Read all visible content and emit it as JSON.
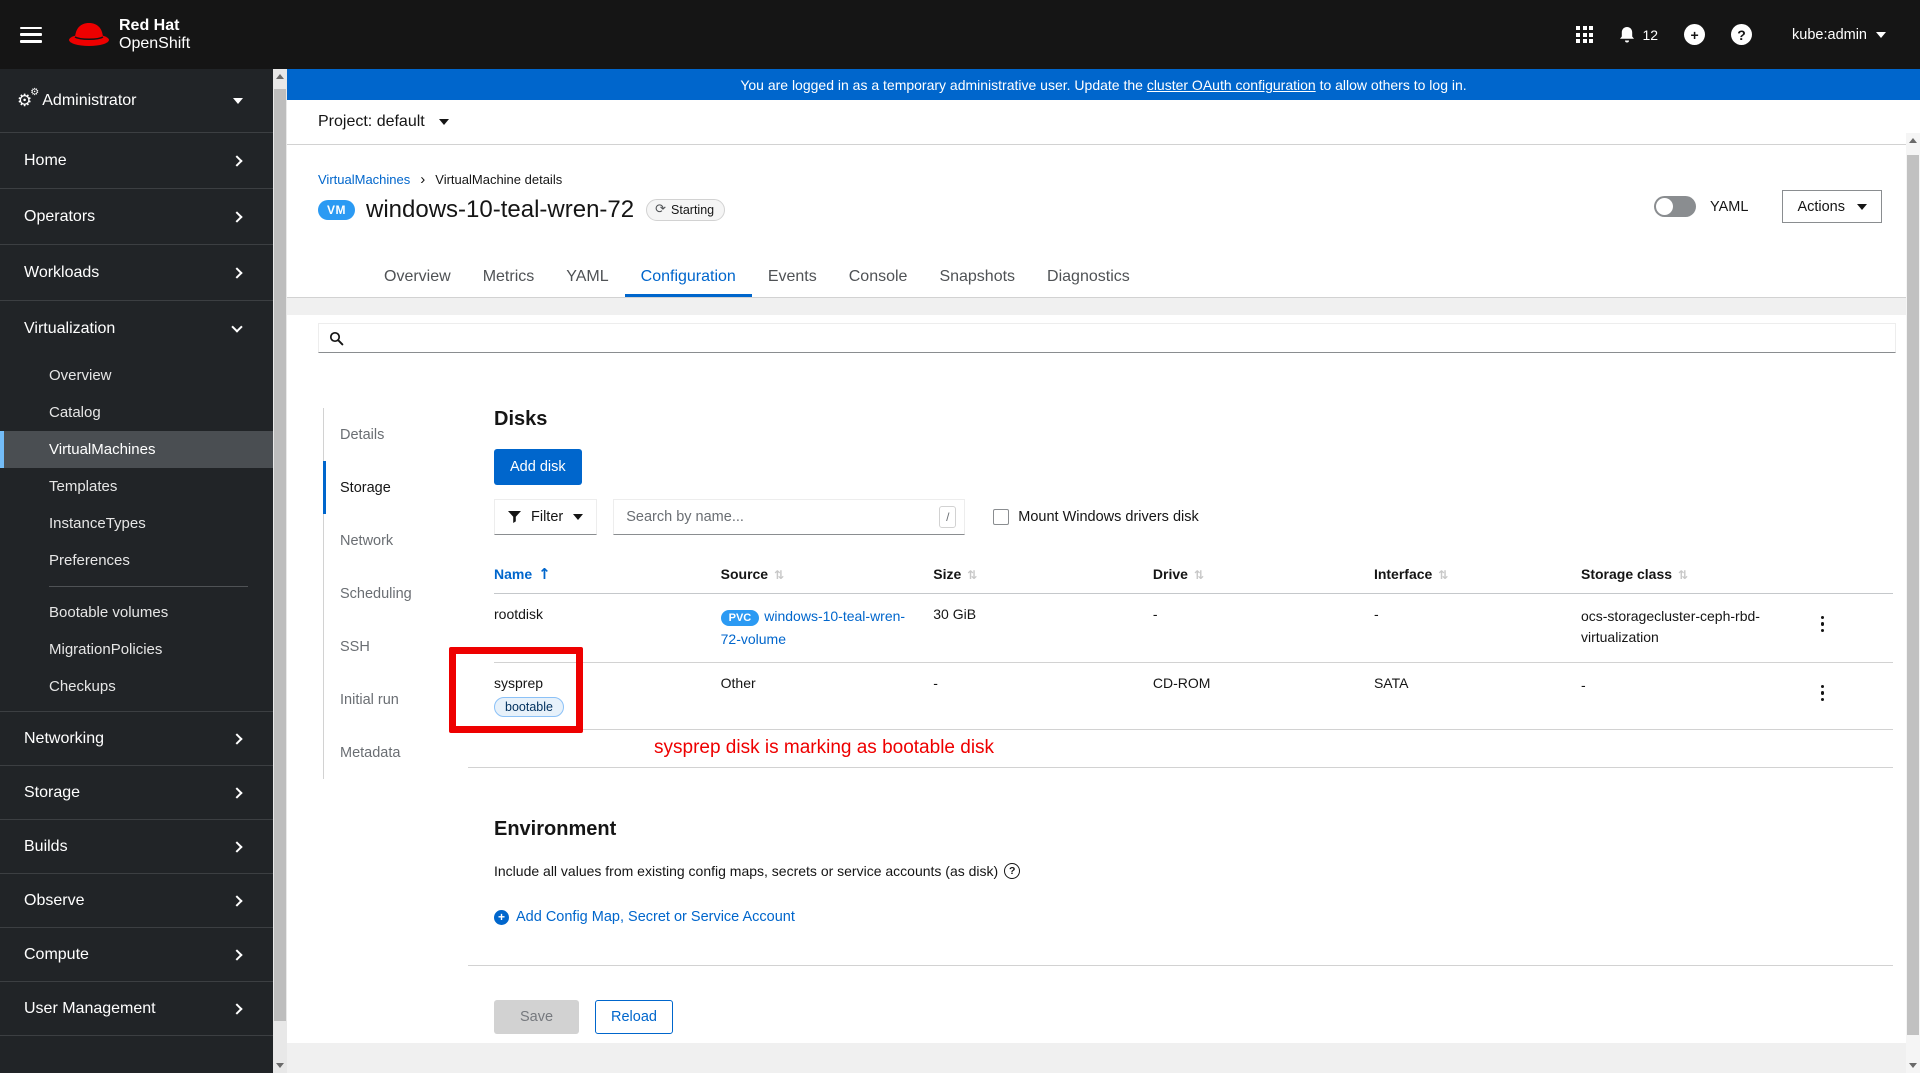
{
  "masthead": {
    "brand_line1": "Red Hat",
    "brand_line2": "OpenShift",
    "notification_count": "12",
    "user": "kube:admin"
  },
  "banner": {
    "prefix": "You are logged in as a temporary administrative user. Update the ",
    "link_text": "cluster OAuth configuration",
    "suffix": " to allow others to log in."
  },
  "project_bar": {
    "label": "Project: default"
  },
  "sidebar": {
    "perspective": "Administrator",
    "items": [
      "Home",
      "Operators",
      "Workloads",
      "Virtualization",
      "Networking",
      "Storage",
      "Builds",
      "Observe",
      "Compute",
      "User Management"
    ],
    "virtualization_children": [
      "Overview",
      "Catalog",
      "VirtualMachines",
      "Templates",
      "InstanceTypes",
      "Preferences",
      "Bootable volumes",
      "MigrationPolicies",
      "Checkups"
    ],
    "active_child": "VirtualMachines"
  },
  "breadcrumb": {
    "link": "VirtualMachines",
    "current": "VirtualMachine details"
  },
  "page_header": {
    "badge": "VM",
    "title": "windows-10-teal-wren-72",
    "status": "Starting",
    "yaml_label": "YAML",
    "actions_label": "Actions"
  },
  "tabs": {
    "items": [
      "Overview",
      "Metrics",
      "YAML",
      "Configuration",
      "Events",
      "Console",
      "Snapshots",
      "Diagnostics"
    ],
    "active": "Configuration"
  },
  "config_nav": {
    "items": [
      "Details",
      "Storage",
      "Network",
      "Scheduling",
      "SSH",
      "Initial run",
      "Metadata"
    ],
    "active": "Storage"
  },
  "disks": {
    "title": "Disks",
    "add_button": "Add disk",
    "filter_label": "Filter",
    "search_placeholder": "Search by name...",
    "shortcut_key": "/",
    "mount_checkbox_label": "Mount Windows drivers disk",
    "columns": [
      "Name",
      "Source",
      "Size",
      "Drive",
      "Interface",
      "Storage class"
    ],
    "rows": [
      {
        "name": "rootdisk",
        "source_badge": "PVC",
        "source_text": "windows-10-teal-wren-72-volume",
        "size": "30 GiB",
        "drive": "-",
        "interface": "-",
        "storage_class": "ocs-storagecluster-ceph-rbd-virtualization"
      },
      {
        "name": "sysprep",
        "bootable_label": "bootable",
        "source_text": "Other",
        "size": "-",
        "drive": "CD-ROM",
        "interface": "SATA",
        "storage_class": "-"
      }
    ],
    "annotation": "sysprep disk is marking as bootable disk"
  },
  "environment": {
    "title": "Environment",
    "description": "Include all values from existing config maps, secrets or service accounts (as disk)",
    "add_link": "Add Config Map, Secret or Service Account"
  },
  "footer": {
    "save": "Save",
    "reload": "Reload"
  },
  "icons": {
    "sort_asc": "↑",
    "sort_none": "⇅",
    "status_spinner": "⟳",
    "breadcrumb_separator": "›",
    "help": "?",
    "plus": "+",
    "cogs": "⚙"
  },
  "colors": {
    "accent_blue": "#0066cc",
    "badge_blue": "#2b9af3",
    "annotation_red": "#ee0000",
    "masthead_bg": "#151515",
    "sidebar_bg": "#212427",
    "banner_bg": "#0066cc"
  }
}
